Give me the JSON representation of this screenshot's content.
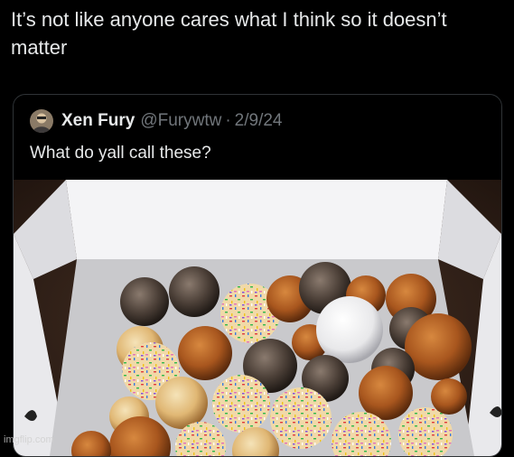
{
  "caption": "It’s not like anyone cares what I think so it doesn’t matter",
  "tweet": {
    "author_name": "Xen Fury",
    "handle": "@Furywtw",
    "separator": "·",
    "date": "2/9/24",
    "text": "What do yall call these?"
  },
  "photo": {
    "description_icon": "donut-holes-box-photo"
  },
  "watermark": "imgflip.com",
  "colors": {
    "background": "#000000",
    "text": "#e7e9ea",
    "muted": "#71767b",
    "border": "#2f3336"
  }
}
